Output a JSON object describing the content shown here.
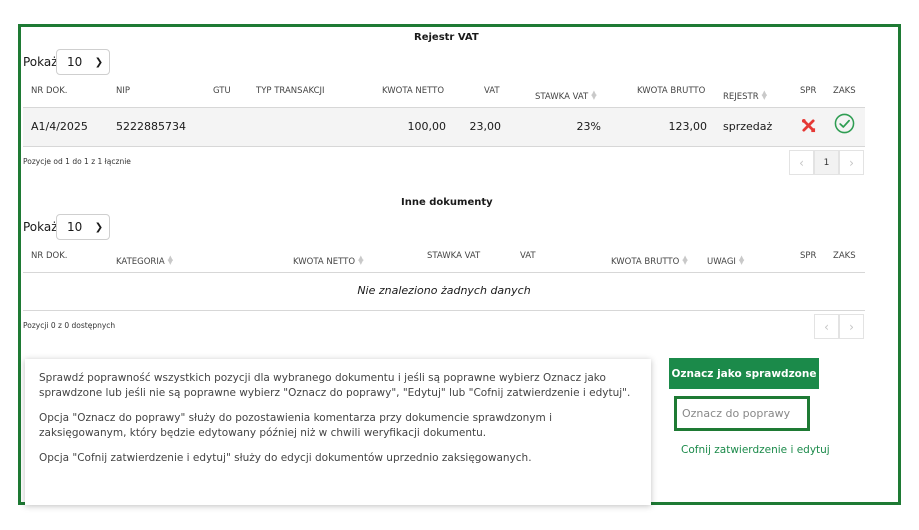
{
  "vat_register": {
    "title": "Rejestr VAT",
    "show_label": "Pokaż",
    "page_size": "10",
    "columns": {
      "nr_dok": "NR DOK.",
      "nip": "NIP",
      "gtu": "GTU",
      "typ_transakcji": "TYP TRANSAKCJI",
      "kwota_netto": "KWOTA NETTO",
      "vat": "VAT",
      "stawka_vat": "STAWKA VAT",
      "kwota_brutto": "KWOTA BRUTTO",
      "rejestr": "REJESTR",
      "spr": "SPR",
      "zaks": "ZAKS"
    },
    "rows": [
      {
        "nr_dok": "A1/4/2025",
        "nip": "5222885734",
        "gtu": "",
        "typ_transakcji": "",
        "kwota_netto": "100,00",
        "vat": "23,00",
        "stawka_vat": "23%",
        "kwota_brutto": "123,00",
        "rejestr": "sprzedaż",
        "spr_icon": "tools-icon",
        "zaks_icon": "check-circle-icon"
      }
    ],
    "summary": "Pozycje od 1 do 1 z 1 łącznie",
    "pagination": {
      "prev": "‹",
      "current": "1",
      "next": "›"
    }
  },
  "other_documents": {
    "title": "Inne dokumenty",
    "show_label": "Pokaż",
    "page_size": "10",
    "columns": {
      "nr_dok": "NR DOK.",
      "kategoria": "KATEGORIA",
      "kwota_netto": "KWOTA NETTO",
      "stawka_vat": "STAWKA VAT",
      "vat": "VAT",
      "kwota_brutto": "KWOTA BRUTTO",
      "uwagi": "UWAGI",
      "spr": "SPR",
      "zaks": "ZAKS"
    },
    "empty_message": "Nie znaleziono żadnych danych",
    "summary": "Pozycji 0 z 0 dostępnych",
    "pagination": {
      "prev": "‹",
      "next": "›"
    }
  },
  "info": {
    "paragraph1": "Sprawdź poprawność wszystkich pozycji dla wybranego dokumentu i jeśli są poprawne wybierz Oznacz jako sprawdzone lub jeśli nie są poprawne wybierz \"Oznacz do poprawy\", \"Edytuj\" lub \"Cofnij zatwierdzenie i edytuj\".",
    "paragraph2": "Opcja \"Oznacz do poprawy\" służy do pozostawienia komentarza przy dokumencie sprawdzonym i zaksięgowanym, który będzie edytowany później niż w chwili weryfikacji dokumentu.",
    "paragraph3": "Opcja \"Cofnij zatwierdzenie i edytuj\" służy do edycji dokumentów uprzednio zaksięgowanych."
  },
  "actions": {
    "mark_checked": "Oznacz jako sprawdzone",
    "mark_to_fix": "Oznacz do poprawy",
    "revert_edit": "Cofnij zatwierdzenie i edytuj"
  },
  "colors": {
    "brand_green": "#1b8a4a",
    "frame_green": "#1e7a34",
    "error_red": "#e53935",
    "success_green": "#2e9d52"
  }
}
